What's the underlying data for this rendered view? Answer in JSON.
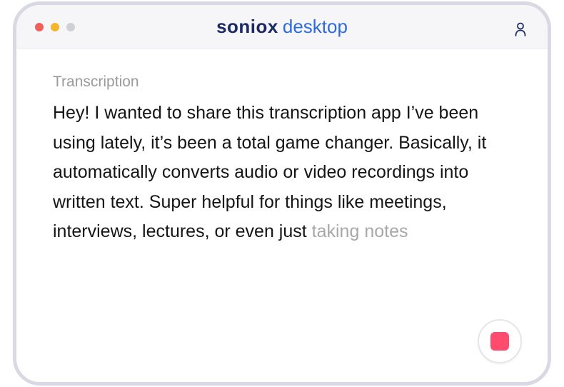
{
  "window": {
    "brand": {
      "name": "soniox",
      "suffix": "desktop",
      "name_color": "#1d2b63",
      "suffix_color": "#2f6bd8"
    },
    "traffic_lights": [
      {
        "name": "close",
        "color": "#f0605b"
      },
      {
        "name": "minimize",
        "color": "#f5b62b"
      },
      {
        "name": "zoom",
        "color": "#cfcfd6"
      }
    ],
    "account_icon": "person-icon"
  },
  "main": {
    "label": "Transcription",
    "transcript_final": "Hey! I wanted to share this transcription app I’ve been using lately, it’s been a total game changer. Basically, it automatically converts audio or video recordings into written text. Super helpful for things like meetings, interviews, lectures, or even just ",
    "transcript_pending": "taking notes"
  },
  "controls": {
    "stop_icon": "stop-icon",
    "stop_color": "#ff4b6e"
  }
}
